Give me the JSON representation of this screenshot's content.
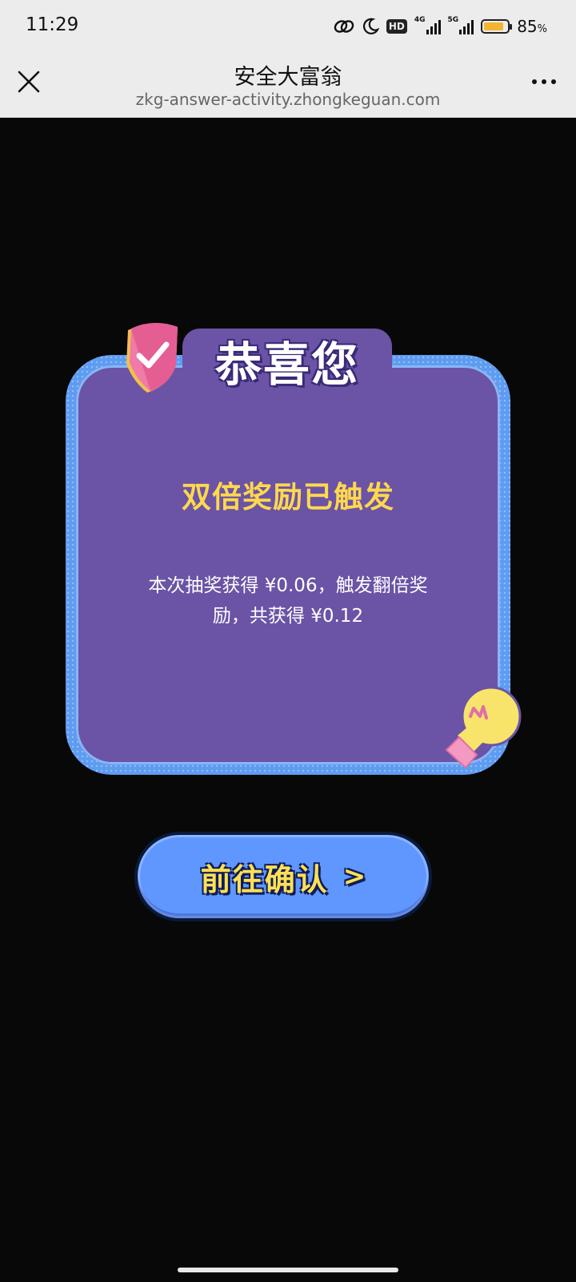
{
  "status_bar": {
    "time": "11:29",
    "hd_badge": "HD",
    "network_tag_1": "4G",
    "network_tag_2": "5G",
    "battery_percent": "85",
    "battery_unit": "%",
    "battery_level": 0.85,
    "icons": [
      "link-icon",
      "moon-icon",
      "hd-icon",
      "signal-icon",
      "battery-icon"
    ]
  },
  "nav": {
    "title": "安全大富翁",
    "url": "zkg-answer-activity.zhongkeguan.com",
    "close_icon": "close-icon",
    "more_icon": "more-icon"
  },
  "modal": {
    "header": "恭喜您",
    "subtitle": "双倍奖励已触发",
    "message": "本次抽奖获得 ¥0.06，触发翻倍奖励，共获得 ¥0.12",
    "colors": {
      "card": "#6b53a6",
      "frame": "#5e9cf2",
      "subtitle": "#ffd84d"
    }
  },
  "actions": {
    "confirm_label": "前往确认",
    "confirm_arrow": ">",
    "button_color": "#5f97ff"
  }
}
